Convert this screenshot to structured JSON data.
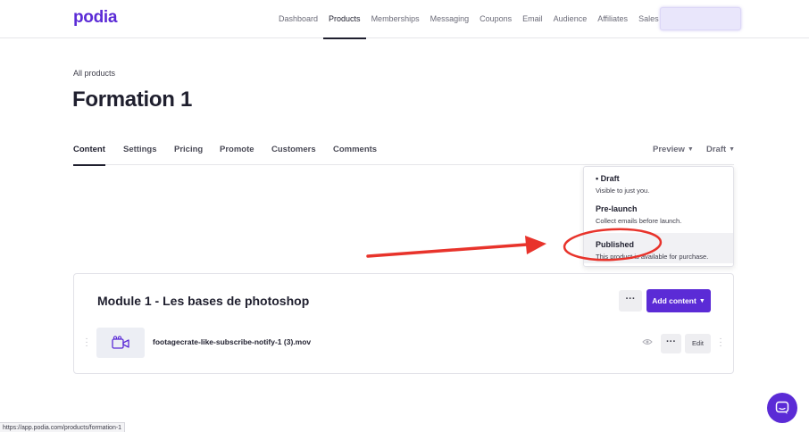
{
  "app": {
    "logo_text": "podia",
    "brand_color": "#5b2bd6"
  },
  "nav": {
    "items": [
      "Dashboard",
      "Products",
      "Memberships",
      "Messaging",
      "Coupons",
      "Email",
      "Audience",
      "Affiliates",
      "Sales"
    ],
    "active": "Products"
  },
  "header": {
    "breadcrumb": "All products",
    "title": "Formation 1"
  },
  "tabs": {
    "items": [
      "Content",
      "Settings",
      "Pricing",
      "Promote",
      "Customers",
      "Comments"
    ],
    "active": "Content",
    "preview_label": "Preview",
    "status_label": "Draft"
  },
  "status_dropdown": {
    "options": [
      {
        "title": "Draft",
        "description": "Visible to just you.",
        "selected": true
      },
      {
        "title": "Pre-launch",
        "description": "Collect emails before launch.",
        "selected": false
      },
      {
        "title": "Published",
        "description": "This product is available for purchase.",
        "selected": false
      }
    ],
    "bullet": "•",
    "highlighted": "Published"
  },
  "module": {
    "title": "Module 1 - Les bases de photoshop",
    "more_label": "···",
    "add_content_label": "Add content",
    "items": [
      {
        "file_name": "footagecrate-like-subscribe-notify-1 (3).mov",
        "more_label": "···",
        "edit_label": "Edit",
        "icon": "video-camera-icon"
      }
    ]
  },
  "annotation": {
    "color": "#e8332b"
  },
  "status_bar": {
    "url": "https://app.podia.com/products/formation-1"
  }
}
